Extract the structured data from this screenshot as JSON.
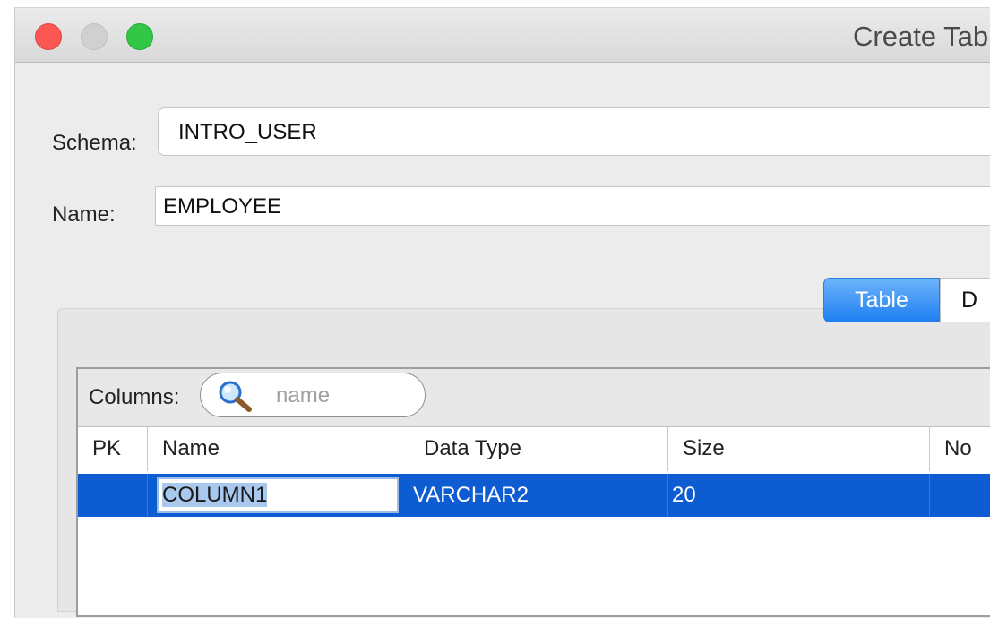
{
  "window": {
    "title": "Create Table"
  },
  "form": {
    "schema_label": "Schema:",
    "schema_value": "INTRO_USER",
    "name_label": "Name:",
    "name_value": "EMPLOYEE"
  },
  "tabs": [
    {
      "label": "Table",
      "selected": true
    },
    {
      "label": "D",
      "selected": false
    }
  ],
  "columns_filter": {
    "label": "Columns:",
    "placeholder": "name",
    "icon": "search-icon"
  },
  "table": {
    "headers": [
      "PK",
      "Name",
      "Data Type",
      "Size",
      "No"
    ],
    "rows": [
      {
        "pk": "",
        "name": "COLUMN1",
        "data_type": "VARCHAR2",
        "size": "20",
        "not_null": ""
      }
    ]
  },
  "colors": {
    "selection": "#0e5cd1",
    "tab_accent": "#1f7ff2",
    "close": "#fc5753",
    "maximize": "#33c748"
  }
}
